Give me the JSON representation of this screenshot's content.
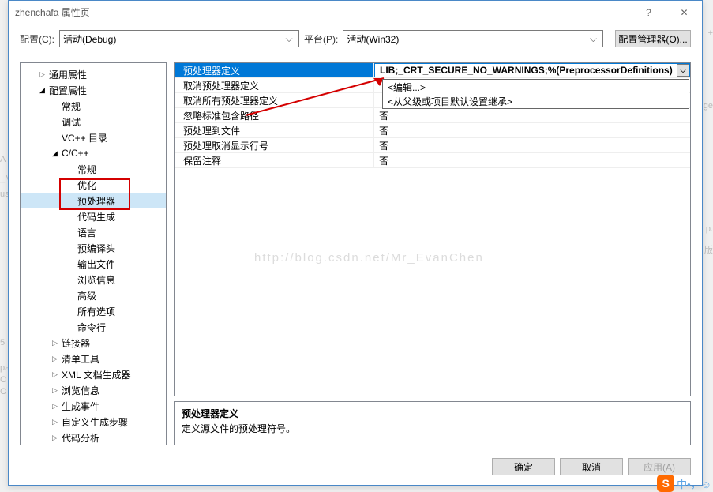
{
  "window": {
    "title": "zhenchafa 属性页",
    "help": "?",
    "close": "✕"
  },
  "toprow": {
    "config_label": "配置(C):",
    "config_value": "活动(Debug)",
    "platform_label": "平台(P):",
    "platform_value": "活动(Win32)",
    "cfgmgr": "配置管理器(O)..."
  },
  "tree": [
    {
      "d": 1,
      "tri": "▷",
      "txt": "通用属性"
    },
    {
      "d": 1,
      "tri": "◢",
      "txt": "配置属性"
    },
    {
      "d": 2,
      "tri": "",
      "txt": "常规"
    },
    {
      "d": 2,
      "tri": "",
      "txt": "调试"
    },
    {
      "d": 2,
      "tri": "",
      "txt": "VC++ 目录"
    },
    {
      "d": 2,
      "tri": "◢",
      "txt": "C/C++"
    },
    {
      "d": 3,
      "tri": "",
      "txt": "常规"
    },
    {
      "d": 3,
      "tri": "",
      "txt": "优化"
    },
    {
      "d": 3,
      "tri": "",
      "txt": "预处理器",
      "sel": true
    },
    {
      "d": 3,
      "tri": "",
      "txt": "代码生成"
    },
    {
      "d": 3,
      "tri": "",
      "txt": "语言"
    },
    {
      "d": 3,
      "tri": "",
      "txt": "预编译头"
    },
    {
      "d": 3,
      "tri": "",
      "txt": "输出文件"
    },
    {
      "d": 3,
      "tri": "",
      "txt": "浏览信息"
    },
    {
      "d": 3,
      "tri": "",
      "txt": "高级"
    },
    {
      "d": 3,
      "tri": "",
      "txt": "所有选项"
    },
    {
      "d": 3,
      "tri": "",
      "txt": "命令行"
    },
    {
      "d": 2,
      "tri": "▷",
      "txt": "链接器"
    },
    {
      "d": 2,
      "tri": "▷",
      "txt": "清单工具"
    },
    {
      "d": 2,
      "tri": "▷",
      "txt": "XML 文档生成器"
    },
    {
      "d": 2,
      "tri": "▷",
      "txt": "浏览信息"
    },
    {
      "d": 2,
      "tri": "▷",
      "txt": "生成事件"
    },
    {
      "d": 2,
      "tri": "▷",
      "txt": "自定义生成步骤"
    },
    {
      "d": 2,
      "tri": "▷",
      "txt": "代码分析"
    }
  ],
  "grid": [
    {
      "lbl": "预处理器定义",
      "val": "LIB;_CRT_SECURE_NO_WARNINGS;%(PreprocessorDefinitions)",
      "sel": true
    },
    {
      "lbl": "取消预处理器定义",
      "val": ""
    },
    {
      "lbl": "取消所有预处理器定义",
      "val": ""
    },
    {
      "lbl": "忽略标准包含路径",
      "val": "否"
    },
    {
      "lbl": "预处理到文件",
      "val": "否"
    },
    {
      "lbl": "预处理取消显示行号",
      "val": "否"
    },
    {
      "lbl": "保留注释",
      "val": "否"
    }
  ],
  "popup": [
    "<编辑...>",
    "<从父级或项目默认设置继承>"
  ],
  "watermark": "http://blog.csdn.net/Mr_EvanChen",
  "desc": {
    "h": "预处理器定义",
    "t": "定义源文件的预处理符号。"
  },
  "footer": {
    "ok": "确定",
    "cancel": "取消",
    "apply": "应用(A)"
  },
  "corner": {
    "s": "S",
    "txt": "中•，☺"
  }
}
